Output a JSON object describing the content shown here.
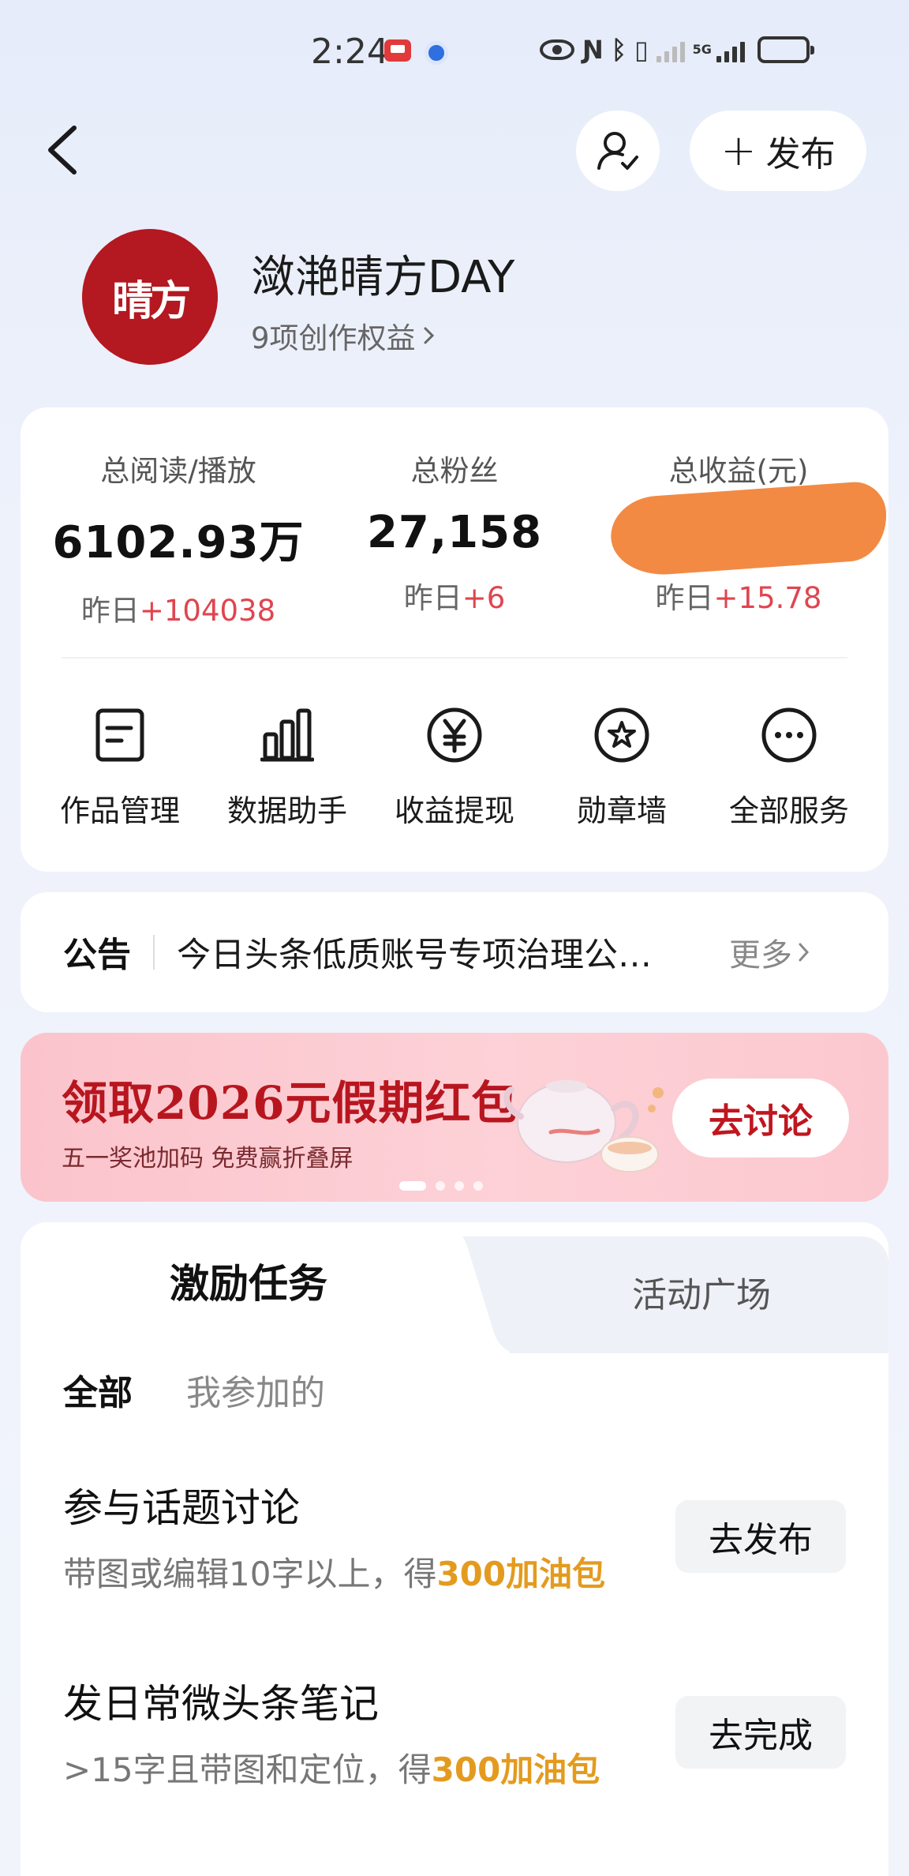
{
  "status_bar": {
    "time": "2:24",
    "network": "5G",
    "icons": [
      "red-app-icon",
      "blue-app-icon",
      "eye-icon",
      "nfc-icon",
      "bluetooth-icon",
      "vibrate-icon",
      "signal-off-icon",
      "signal-5g-icon",
      "battery-icon"
    ]
  },
  "header": {
    "back_icon": "chevron-left-icon",
    "user_icon": "user-check-icon",
    "publish_label": "发布"
  },
  "profile": {
    "avatar_text": "晴方",
    "name": "潋滟晴方DAY",
    "benefits": "9项创作权益"
  },
  "stats": [
    {
      "label": "总阅读/播放",
      "value": "6102.93万",
      "delta_prefix": "昨日",
      "delta": "+104038"
    },
    {
      "label": "总粉丝",
      "value": "27,158",
      "delta_prefix": "昨日",
      "delta": "+6"
    },
    {
      "label": "总收益(元)",
      "value": "",
      "delta_prefix": "昨日",
      "delta": "+15.78"
    }
  ],
  "services": [
    {
      "label": "作品管理",
      "icon": "document-icon"
    },
    {
      "label": "数据助手",
      "icon": "bar-chart-icon"
    },
    {
      "label": "收益提现",
      "icon": "yuan-icon"
    },
    {
      "label": "勋章墙",
      "icon": "medal-icon"
    },
    {
      "label": "全部服务",
      "icon": "more-icon"
    }
  ],
  "notice": {
    "title": "公告",
    "text": "今日头条低质账号专项治理公…",
    "more": "更多"
  },
  "banner": {
    "title": "领取2026元假期红包",
    "subtitle": "五一奖池加码 免费赢折叠屏",
    "button": "去讨论",
    "page_count": 4,
    "active_page": 1,
    "colors": {
      "title": "#b8161f",
      "background": "#fcc8cf"
    }
  },
  "tasks": {
    "tabs": [
      "激励任务",
      "活动广场"
    ],
    "active_tab": 0,
    "filters": [
      "全部",
      "我参加的"
    ],
    "active_filter": 0,
    "items": [
      {
        "name": "参与话题讨论",
        "desc": "带图或编辑10字以上，得",
        "reward": "300加油包",
        "button": "去发布"
      },
      {
        "name": "发日常微头条笔记",
        "desc": ">15字且带图和定位，得",
        "reward": "300加油包",
        "button": "去完成"
      }
    ],
    "accent_color": "#e39b1f"
  }
}
